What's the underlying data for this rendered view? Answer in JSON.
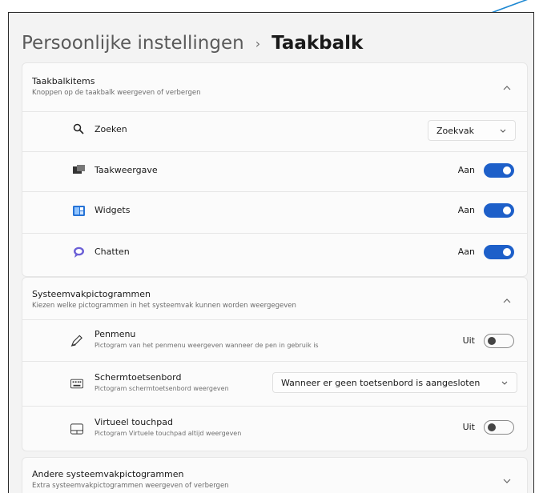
{
  "breadcrumb": {
    "parent": "Persoonlijke instellingen",
    "separator": "›",
    "current": "Taakbalk"
  },
  "taskbar_items": {
    "title": "Taakbalkitems",
    "description": "Knoppen op de taakbalk weergeven of verbergen",
    "rows": [
      {
        "icon": "search-icon",
        "label": "Zoeken",
        "control": "dropdown",
        "value": "Zoekvak"
      },
      {
        "icon": "task-view-icon",
        "label": "Taakweergave",
        "control": "toggle",
        "state": "Aan",
        "on": true
      },
      {
        "icon": "widgets-icon",
        "label": "Widgets",
        "control": "toggle",
        "state": "Aan",
        "on": true
      },
      {
        "icon": "chat-icon",
        "label": "Chatten",
        "control": "toggle",
        "state": "Aan",
        "on": true
      }
    ]
  },
  "system_tray": {
    "title": "Systeemvakpictogrammen",
    "description": "Kiezen welke pictogrammen in het systeemvak kunnen worden weergegeven",
    "rows": [
      {
        "icon": "pen-icon",
        "label": "Penmenu",
        "sub": "Pictogram van het penmenu weergeven wanneer de pen in gebruik is",
        "control": "toggle",
        "state": "Uit",
        "on": false
      },
      {
        "icon": "keyboard-icon",
        "label": "Schermtoetsenbord",
        "sub": "Pictogram schermtoetsenbord weergeven",
        "control": "dropdown",
        "value": "Wanneer er geen toetsenbord is aangesloten"
      },
      {
        "icon": "touchpad-icon",
        "label": "Virtueel touchpad",
        "sub": "Pictogram Virtuele touchpad altijd weergeven",
        "control": "toggle",
        "state": "Uit",
        "on": false
      }
    ]
  },
  "other_tray": {
    "title": "Andere systeemvakpictogrammen",
    "description": "Extra systeemvakpictogrammen weergeven of verbergen"
  },
  "colors": {
    "accent": "#1d5fc9",
    "frame_border": "#2a2a2a",
    "annotation_arrow": "#1e88d2"
  }
}
